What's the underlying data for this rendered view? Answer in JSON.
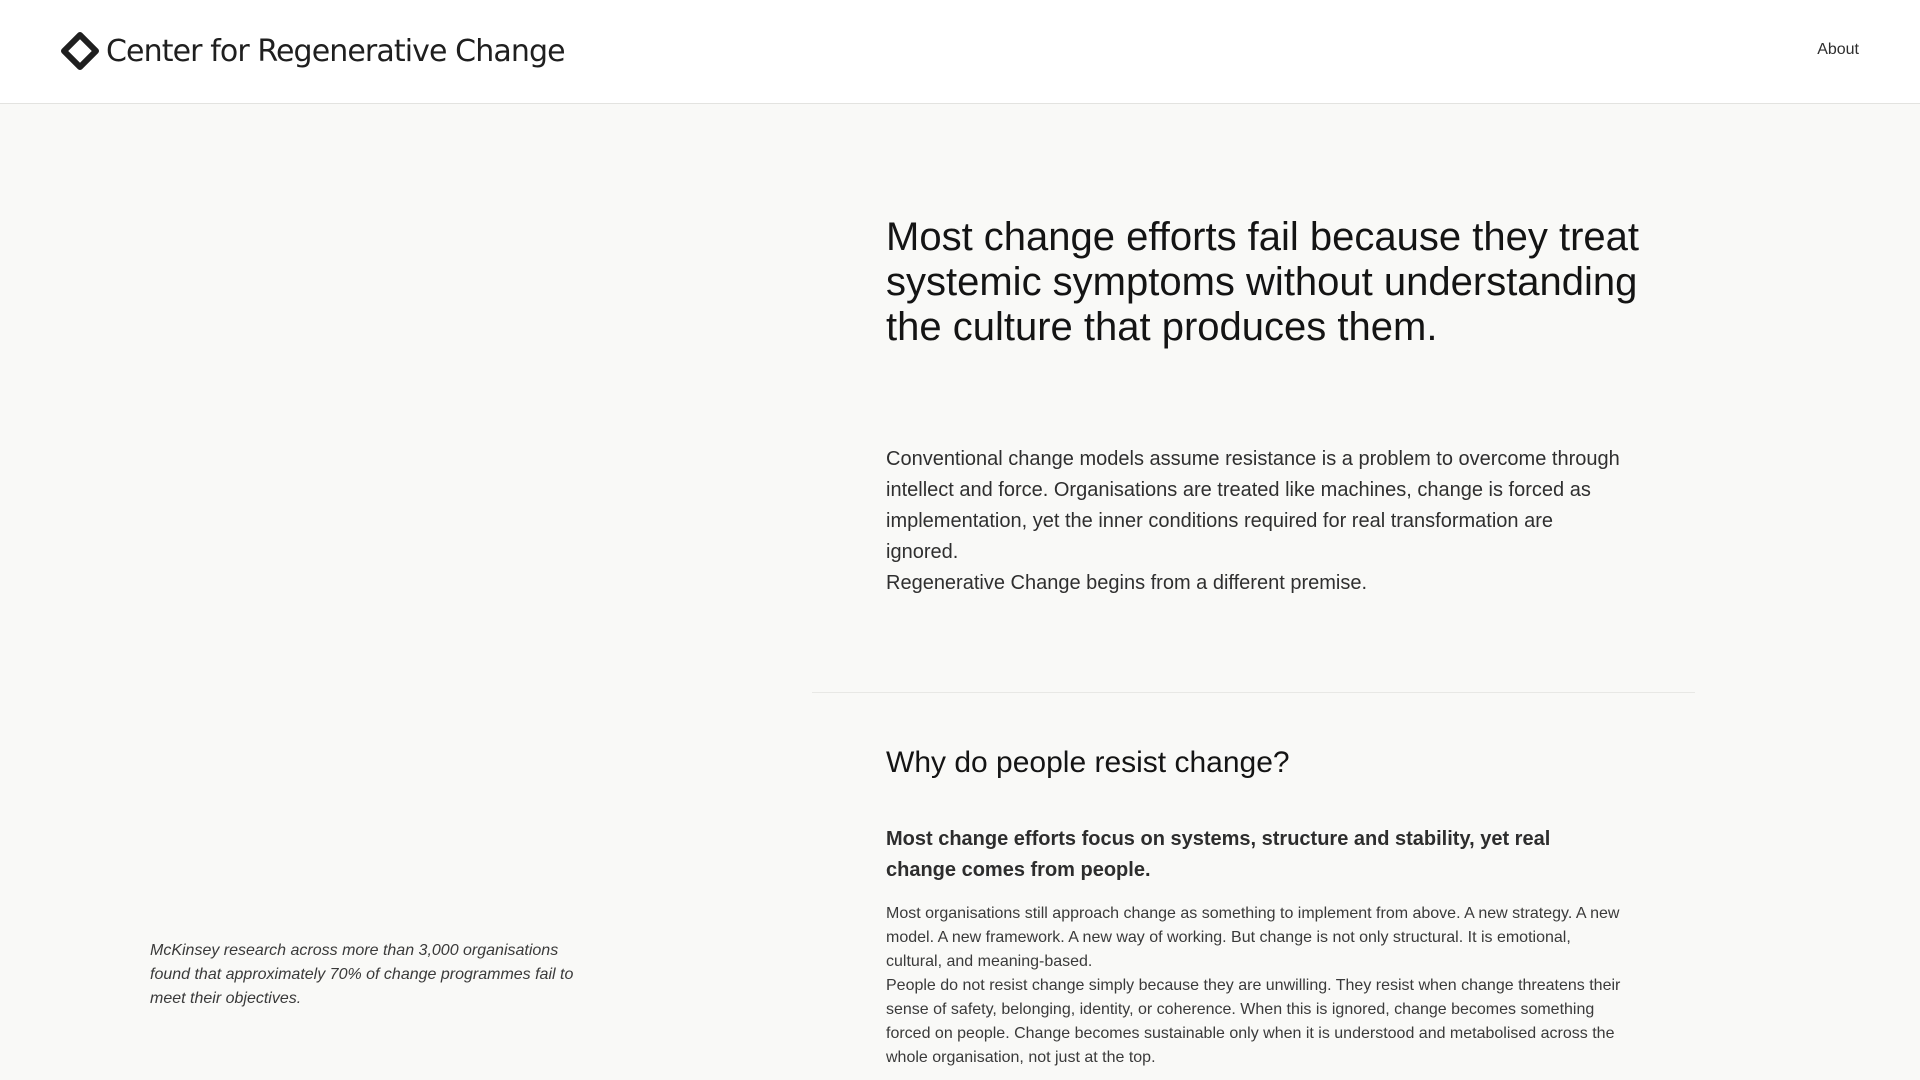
{
  "header": {
    "brand_name": "Center for Regenerative Change",
    "logo_icon": "diamond-logo-icon",
    "nav": [
      {
        "label": "About"
      }
    ]
  },
  "hero": {
    "heading": "Most change efforts fail because they treat systemic symptoms without understanding the culture that produces them."
  },
  "intro": {
    "paragraph": "Conventional change models assume resistance is a problem to overcome through intellect and force. Organisations are treated like machines, change is forced as implementation, yet the inner conditions required for real transformation are ignored.",
    "premise": "Regenerative Change begins from a different premise."
  },
  "resistance_section": {
    "heading": "Why do people resist change?",
    "lead": "Most change efforts focus on systems, structure and stability, yet real change comes from people.",
    "paragraphs": [
      "Most organisations still approach change as something to implement from above. A new strategy. A new model. A new framework. A new way of working. But change is not only structural. It is emotional, cultural, and meaning-based.",
      "People do not resist change simply because they are unwilling. They resist when change threatens their sense of safety, belonging, identity, or coherence. When this is ignored, change becomes something forced on people. Change becomes sustainable only when it is understood and metabolised across the whole organisation, not just at the top."
    ],
    "side_note": "McKinsey research across more than 3,000 organisations found that approximately 70% of change programmes fail to meet their objectives."
  },
  "colors": {
    "page_background": "#f9f9f7",
    "header_background": "#ffffff",
    "heading_text": "#141414",
    "body_text": "#2f2f2f"
  }
}
